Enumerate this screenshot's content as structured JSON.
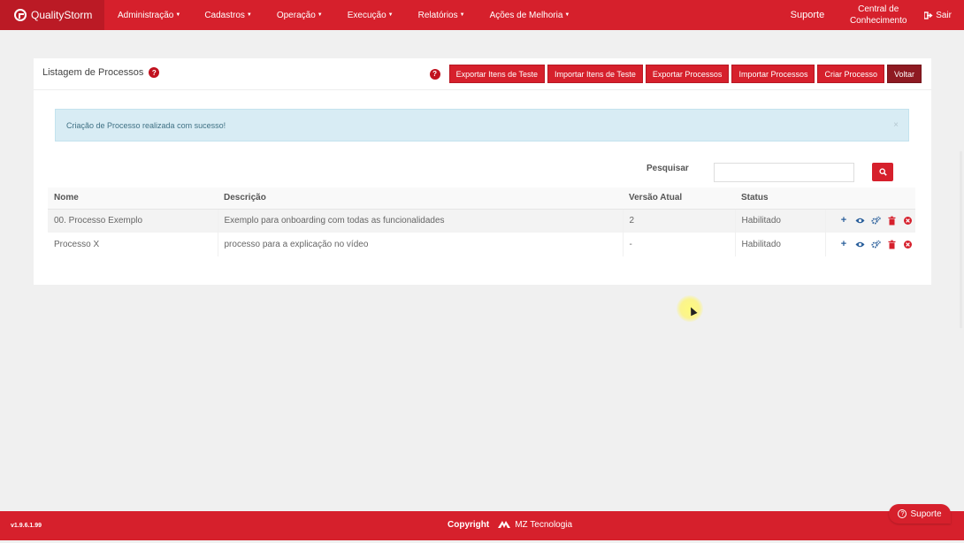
{
  "brand": {
    "name": "QualityStorm"
  },
  "nav": {
    "items": [
      {
        "label": "Administração"
      },
      {
        "label": "Cadastros"
      },
      {
        "label": "Operação"
      },
      {
        "label": "Execução"
      },
      {
        "label": "Relatórios"
      },
      {
        "label": "Ações de Melhoria"
      }
    ],
    "support_label": "Suporte",
    "central_line1": "Central de",
    "central_line2": "Conhecimento",
    "logout_label": "Sair"
  },
  "panel": {
    "title": "Listagem de Processos",
    "help_glyph": "?",
    "buttons": {
      "export_test_items": "Exportar Itens de Teste",
      "import_test_items": "Importar Itens de Teste",
      "export_processes": "Exportar Processos",
      "import_processes": "Importar Processos",
      "create_process": "Criar Processo",
      "back": "Voltar"
    }
  },
  "alert": {
    "message": "Criação de Processo realizada com sucesso!",
    "close_glyph": "×"
  },
  "search": {
    "label": "Pesquisar",
    "value": ""
  },
  "table": {
    "headers": {
      "name": "Nome",
      "description": "Descrição",
      "version": "Versão Atual",
      "status": "Status"
    },
    "rows": [
      {
        "name": "00. Processo Exemplo",
        "description": "Exemplo para onboarding com todas as funcionalidades",
        "version": "2",
        "status": "Habilitado"
      },
      {
        "name": "Processo X",
        "description": "processo para a explicação no vídeo",
        "version": "-",
        "status": "Habilitado"
      }
    ],
    "action_icons": [
      "plus-icon",
      "eye-icon",
      "gears-icon",
      "trash-icon",
      "times-circle-icon"
    ]
  },
  "footer": {
    "version": "v1.9.6.1.99",
    "copyright": "Copyright",
    "company": "MZ Tecnologia",
    "support_button": "Suporte"
  },
  "colors": {
    "brand_red": "#d6202c",
    "brand_dark": "#8e1a22",
    "alert_bg": "#d8ecf4",
    "action_blue": "#2a5f9b"
  }
}
